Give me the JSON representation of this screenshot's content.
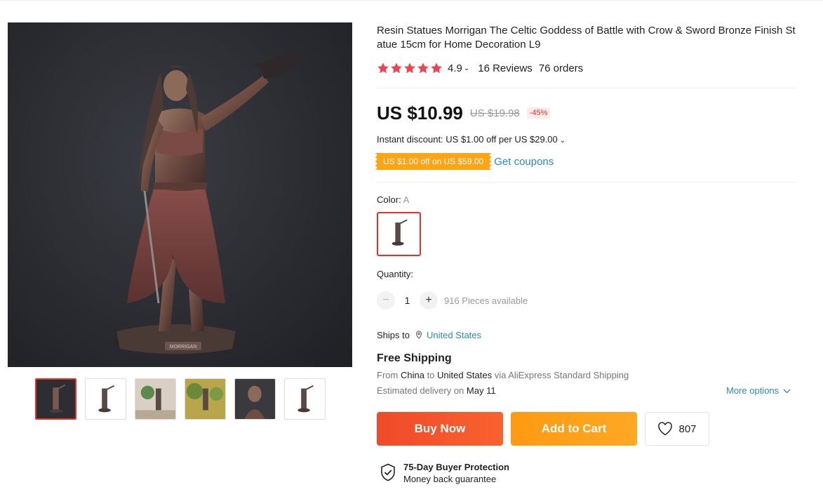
{
  "product": {
    "title": "Resin Statues Morrigan The Celtic Goddess of Battle with Crow & Sword Bronze Finish Statue 15cm for Home Decoration L9",
    "plaque_text": "MORRIGAN"
  },
  "rating": {
    "value": "4.9",
    "stars": 5,
    "reviews": "16 Reviews",
    "orders": "76 orders"
  },
  "price": {
    "current": "US $10.99",
    "original": "US $19.98",
    "discount": "-45%"
  },
  "discounts": {
    "instant": "Instant discount: US $1.00 off per US $29.00",
    "coupon_tag": "US $1.00 off on US $59.00",
    "get_coupons": "Get coupons"
  },
  "variant": {
    "label": "Color:",
    "selected": "A"
  },
  "quantity": {
    "label": "Quantity:",
    "minus": "−",
    "value": "1",
    "plus": "+",
    "available": "916 Pieces available"
  },
  "shipping": {
    "ships_to_label": "Ships to",
    "ships_to_country": "United States",
    "free_shipping": "Free Shipping",
    "from_label": "From",
    "from_country": "China",
    "to_label": "to",
    "to_country": "United States",
    "via_text": "via AliExpress Standard Shipping",
    "estimated_label": "Estimated delivery on",
    "estimated_date": "May 11",
    "more_options": "More options"
  },
  "actions": {
    "buy_now": "Buy Now",
    "add_to_cart": "Add to Cart",
    "wishlist_count": "807"
  },
  "protection": {
    "title": "75-Day Buyer Protection",
    "subtitle": "Money back guarantee"
  },
  "colors": {
    "accent": "#e43225",
    "star": "#f0424f",
    "link": "#2a8bb8",
    "buy_now": "#f04a2a",
    "add_to_cart": "#ff9a12",
    "coupon": "#ffa415"
  }
}
